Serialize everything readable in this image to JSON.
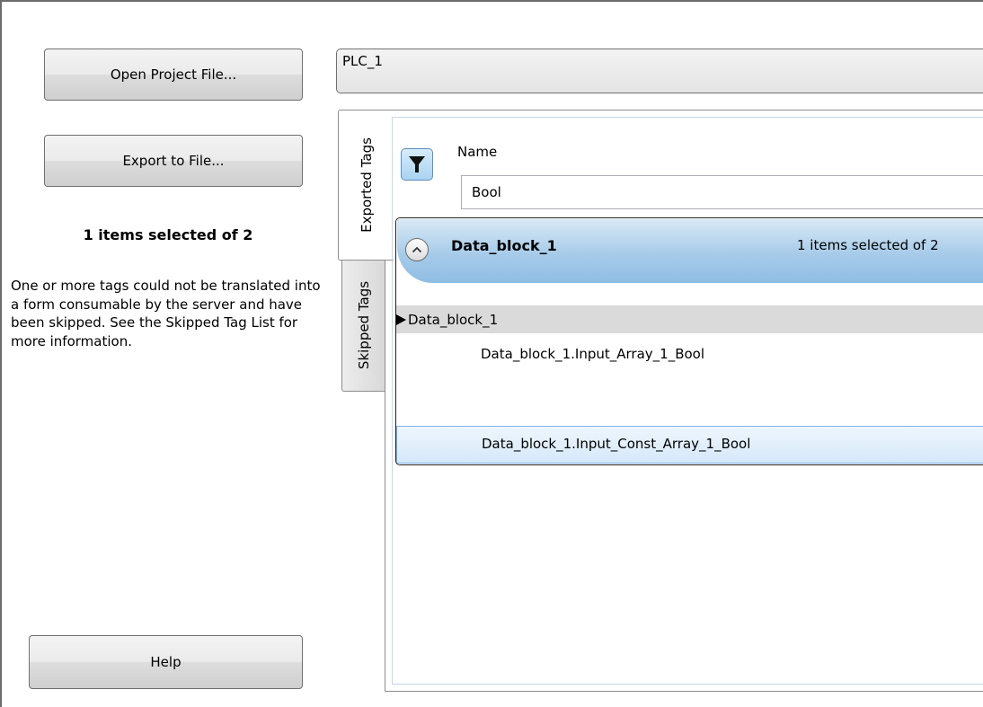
{
  "left_panel": {
    "open_project_label": "Open Project File...",
    "export_label": "Export to File...",
    "selection_summary": "1 items selected of 2",
    "message": "One or more tags could not be translated into a form consumable by the server and have been skipped. See the Skipped Tag List for more information.",
    "help_label": "Help"
  },
  "plc_selector": {
    "value": "PLC_1"
  },
  "tabs": [
    {
      "label": "Exported Tags",
      "active": true
    },
    {
      "label": "Skipped Tags",
      "active": false
    }
  ],
  "filter": {
    "icon": "filter-icon",
    "column_label": "Name",
    "value": "Bool"
  },
  "group": {
    "title": "Data_block_1",
    "count": "1 items selected of 2",
    "collapse_icon": "chevron-up-icon",
    "parent": "Data_block_1",
    "items": [
      {
        "label": "Data_block_1.Input_Array_1_Bool",
        "selected": false
      },
      {
        "label": "Data_block_1.Input_Const_Array_1_Bool",
        "selected": true
      }
    ]
  },
  "colors": {
    "header_blue": "#a7cbe9",
    "selection_blue": "#d6e8f9",
    "tree_parent_gray": "#dadada"
  }
}
